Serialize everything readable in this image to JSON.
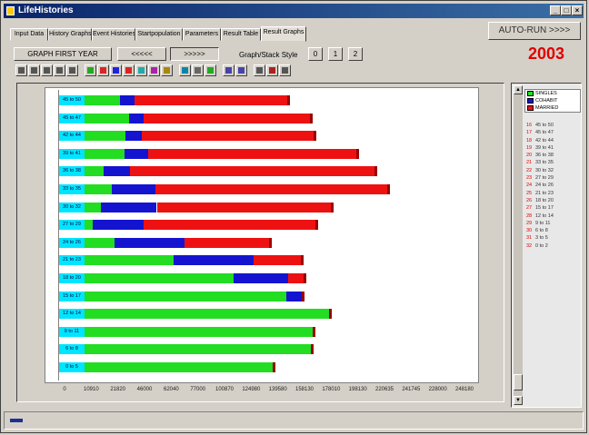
{
  "window": {
    "title": "LifeHistories",
    "min": "_",
    "max": "□",
    "close": "×"
  },
  "tabs": [
    {
      "label": "Input Data",
      "active": false
    },
    {
      "label": "History Graphs",
      "active": false
    },
    {
      "label": "Event Histories",
      "active": false
    },
    {
      "label": "Startpopulation",
      "active": false
    },
    {
      "label": "Parameters",
      "active": false
    },
    {
      "label": "Result Table",
      "active": false
    },
    {
      "label": "Result Graphs",
      "active": true
    }
  ],
  "controls": {
    "graph_first_year": "GRAPH FIRST YEAR",
    "prev": "<<<<<",
    "next": ">>>>>",
    "style_label": "Graph/Stack Style",
    "styles": [
      "0",
      "1",
      "2"
    ],
    "autorun": "AUTO-RUN >>>>",
    "year": "2003"
  },
  "toolbar_icons": [
    "print-icon",
    "save-icon",
    "copy-icon",
    "number-icon",
    "export-icon",
    "chart-bar-icon",
    "chart-bar-icon",
    "chart-bar-icon",
    "chart-line-icon",
    "chart-area-icon",
    "chart-pie-icon",
    "chart-3d-icon",
    "image-icon",
    "grid-icon",
    "legend-icon",
    "zoom-in-icon",
    "zoom-out-icon",
    "font-icon",
    "help-icon",
    "tools-icon"
  ],
  "colors": {
    "singles": "#22dd22",
    "cohabit": "#1414d0",
    "married": "#ee1111",
    "age_label": "#00e5ff",
    "year": "#e00000"
  },
  "chart_data": {
    "type": "bar",
    "orientation": "horizontal",
    "stacked": true,
    "categories": [
      "45 to 50",
      "45 to 47",
      "42 to 44",
      "39 to 41",
      "36 to 38",
      "33 to 35",
      "30 to 32",
      "27 to 29",
      "24 to 26",
      "21 to 23",
      "18 to 20",
      "15 to 17",
      "12 to 14",
      "9 to 11",
      "6 to 8",
      "0 to 5"
    ],
    "series": [
      {
        "name": "SINGLES",
        "values": [
          54000,
          62000,
          59000,
          58000,
          40000,
          47000,
          37000,
          30000,
          49000,
          102000,
          155000,
          202000,
          240000,
          226000,
          224000,
          190000
        ]
      },
      {
        "name": "COHABIT",
        "values": [
          13000,
          13000,
          15000,
          21000,
          23000,
          39000,
          50000,
          45000,
          63000,
          71000,
          49000,
          14000,
          0,
          0,
          0,
          0
        ]
      },
      {
        "name": "MARRIED",
        "values": [
          136000,
          148000,
          153000,
          186000,
          218000,
          206000,
          155000,
          153000,
          75000,
          42000,
          14000,
          0,
          0,
          0,
          0,
          0
        ]
      }
    ],
    "xlim": [
      0,
      348000
    ],
    "xticks": [
      "0",
      "10910",
      "21820",
      "46000",
      "62040",
      "77000",
      "100870",
      "124980",
      "139580",
      "158130",
      "178010",
      "198130",
      "220635",
      "241745",
      "228000",
      "248180"
    ],
    "legend_position": "top-right"
  },
  "side": {
    "legend": [
      {
        "label": "SINGLES",
        "color": "#22dd22"
      },
      {
        "label": "COHABIT",
        "color": "#1414d0"
      },
      {
        "label": "MARRIED",
        "color": "#ee1111"
      }
    ],
    "age_list": [
      {
        "n": "16",
        "range": "45 to 50"
      },
      {
        "n": "17",
        "range": "45 to 47"
      },
      {
        "n": "18",
        "range": "42 to 44"
      },
      {
        "n": "19",
        "range": "39 to 41"
      },
      {
        "n": "20",
        "range": "36 to 38"
      },
      {
        "n": "21",
        "range": "33 to 35"
      },
      {
        "n": "22",
        "range": "30 to 32"
      },
      {
        "n": "23",
        "range": "27 to 29"
      },
      {
        "n": "24",
        "range": "24 to 26"
      },
      {
        "n": "25",
        "range": "21 to 23"
      },
      {
        "n": "26",
        "range": "18 to 20"
      },
      {
        "n": "27",
        "range": "15 to 17"
      },
      {
        "n": "28",
        "range": "12 to 14"
      },
      {
        "n": "29",
        "range": "9 to 11"
      },
      {
        "n": "30",
        "range": "6 to 8"
      },
      {
        "n": "31",
        "range": "3 to 5"
      },
      {
        "n": "32",
        "range": "0 to 2"
      }
    ]
  }
}
